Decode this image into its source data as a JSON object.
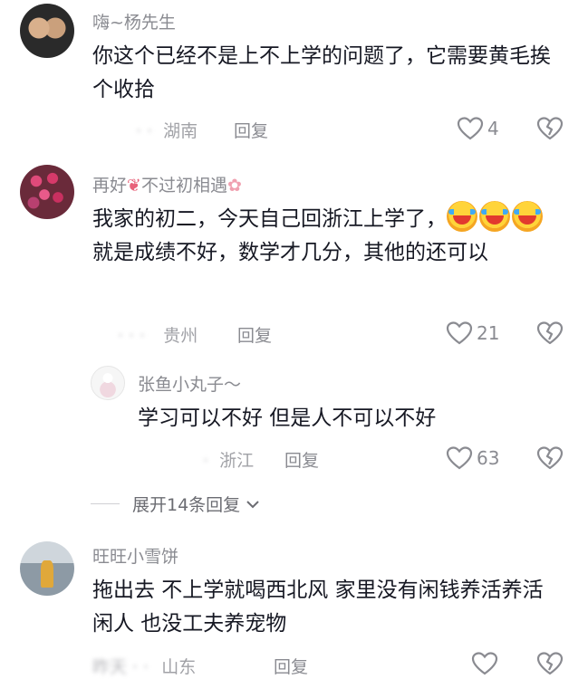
{
  "comments": [
    {
      "name": "嗨~杨先生",
      "text": "你这个已经不是上不上学的问题了，它需要黄毛挨个收拾",
      "time": "· ·",
      "location": "湖南",
      "reply": "回复",
      "likes": "4"
    },
    {
      "name_pre": "再好",
      "name_post": "不过初相遇",
      "text_a": "我家的初二，今天自己回浙江上学了，",
      "text_b": "就是成绩不好，数学才几分，其他的还可以",
      "time": "· · ·",
      "location": "贵州",
      "reply": "回复",
      "likes": "21"
    }
  ],
  "reply": {
    "name": "张鱼小丸子〜",
    "text": "学习可以不好 但是人不可以不好",
    "time": "·",
    "location": "浙江",
    "reply": "回复",
    "likes": "63"
  },
  "expand": {
    "label": "展开14条回复"
  },
  "comment3": {
    "name": "旺旺小雪饼",
    "text": "拖出去 不上学就喝西北风 家里没有闲钱养活养活闲人 也没工夫养宠物",
    "time": "昨天 · ·",
    "location": "山东",
    "reply": "回复"
  },
  "colors": {
    "text": "#161823",
    "muted": "#8a8b91",
    "like_icon": "#8a8b91"
  }
}
